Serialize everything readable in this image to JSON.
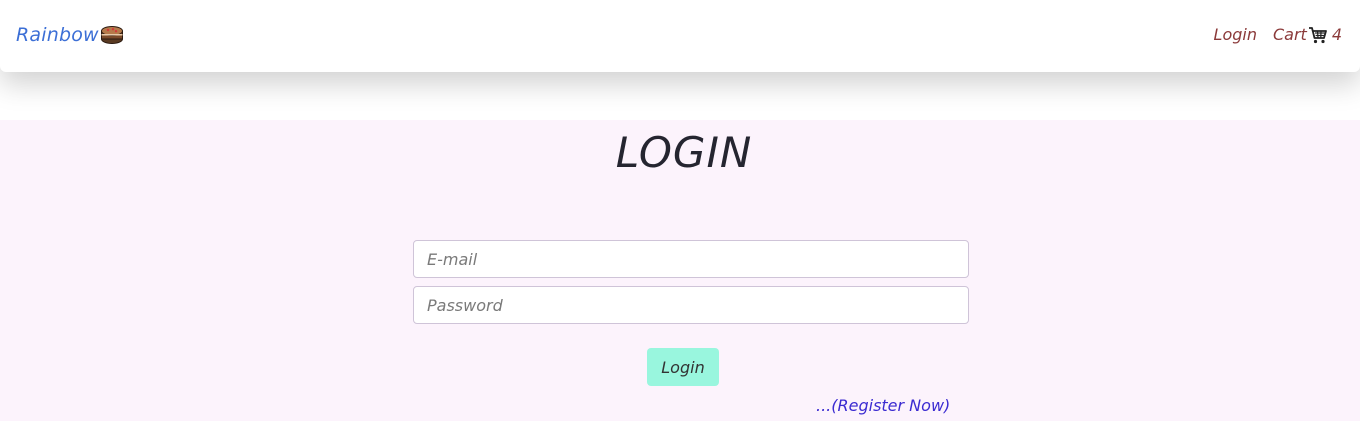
{
  "navbar": {
    "brand_text": "Rainbow",
    "brand_icon": "cake-icon",
    "login_label": "Login",
    "cart_label": "Cart",
    "cart_icon": "cart-icon",
    "cart_count": "4"
  },
  "main": {
    "title": "LOGIN",
    "email_placeholder": "E-mail",
    "password_placeholder": "Password",
    "login_button": "Login",
    "register_link": "...(Register Now)"
  },
  "colors": {
    "brand": "#3c6fd6",
    "nav_link": "#8b3a3a",
    "page_bg": "#fcf3fc",
    "button_bg": "#99f6de",
    "register_link": "#3b2bd1"
  }
}
